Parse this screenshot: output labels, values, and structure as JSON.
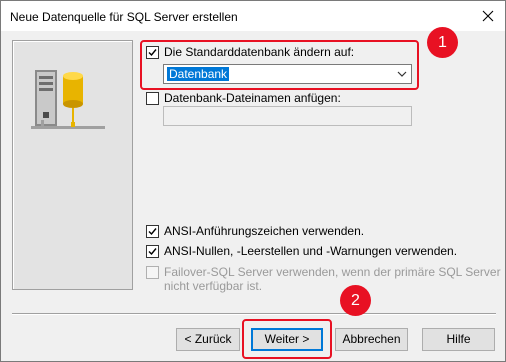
{
  "window": {
    "title": "Neue Datenquelle für SQL Server erstellen"
  },
  "options": {
    "change_default_db": {
      "label": "Die Standarddatenbank ändern auf:",
      "checked": true
    },
    "default_db_value": "Datenbank",
    "attach_db_filename": {
      "label": "Datenbank-Dateinamen anfügen:",
      "checked": false
    },
    "ansi_quotes": {
      "label": "ANSI-Anführungszeichen verwenden.",
      "checked": true
    },
    "ansi_nulls": {
      "label": "ANSI-Nullen, -Leerstellen und -Warnungen verwenden.",
      "checked": true
    },
    "failover": {
      "label_line1": "Failover-SQL Server verwenden, wenn der primäre SQL Server",
      "label_line2": "nicht verfügbar ist.",
      "checked": false,
      "disabled": true
    }
  },
  "buttons": {
    "back": "< Zurück",
    "next": "Weiter >",
    "cancel": "Abbrechen",
    "help": "Hilfe"
  },
  "annotations": {
    "badge1": "1",
    "badge2": "2",
    "color": "#e81123"
  }
}
